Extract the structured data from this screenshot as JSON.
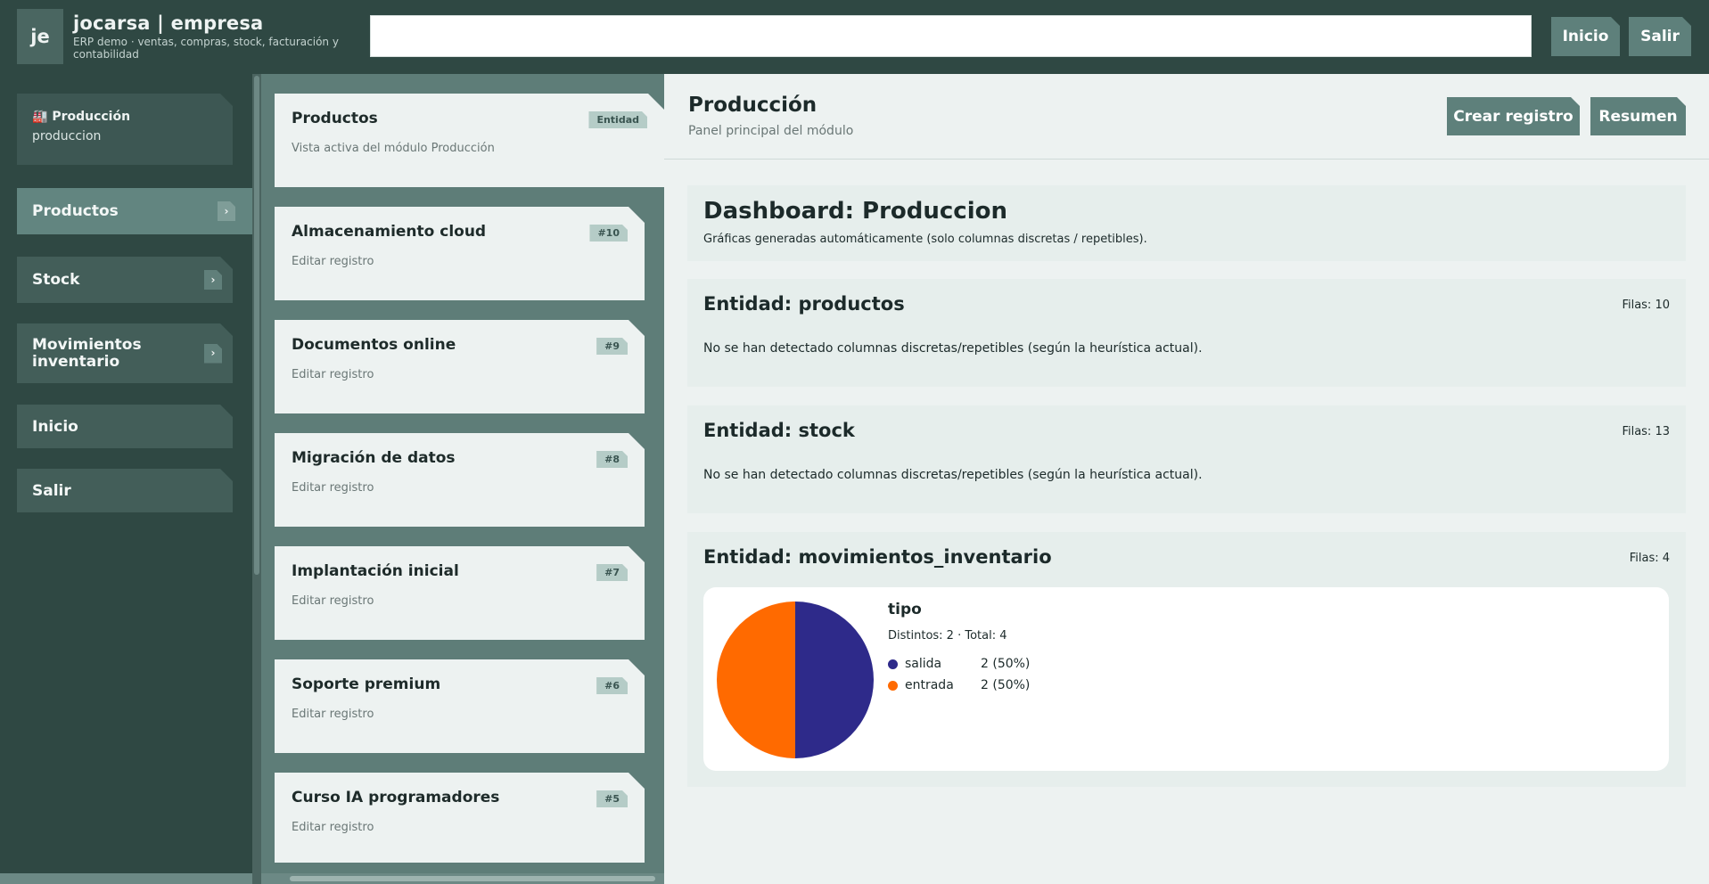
{
  "header": {
    "logo": "je",
    "title": "jocarsa | empresa",
    "subtitle": "ERP demo · ventas, compras, stock, facturación y contabilidad",
    "search_value": "",
    "buttons": [
      "Inicio",
      "Salir"
    ]
  },
  "sidebar": {
    "module": {
      "icon": "🏭",
      "title": "Producción",
      "slug": "produccion"
    },
    "items": [
      {
        "label": "Productos",
        "active": true,
        "chevron": "›"
      },
      {
        "label": "Stock",
        "active": false,
        "chevron": "›"
      },
      {
        "label": "Movimientos inventario",
        "active": false,
        "chevron": "›"
      },
      {
        "label": "Inicio",
        "active": false
      },
      {
        "label": "Salir",
        "active": false
      }
    ]
  },
  "list": {
    "active_card": {
      "title": "Productos",
      "subtitle": "Vista activa del módulo Producción",
      "badge": "Entidad"
    },
    "records": [
      {
        "title": "Almacenamiento cloud",
        "subtitle": "Editar registro",
        "badge": "#10"
      },
      {
        "title": "Documentos online",
        "subtitle": "Editar registro",
        "badge": "#9"
      },
      {
        "title": "Migración de datos",
        "subtitle": "Editar registro",
        "badge": "#8"
      },
      {
        "title": "Implantación inicial",
        "subtitle": "Editar registro",
        "badge": "#7"
      },
      {
        "title": "Soporte premium",
        "subtitle": "Editar registro",
        "badge": "#6"
      },
      {
        "title": "Curso IA programadores",
        "subtitle": "Editar registro",
        "badge": "#5"
      }
    ]
  },
  "main": {
    "title": "Producción",
    "subtitle": "Panel principal del módulo",
    "buttons": {
      "create": "Crear registro",
      "summary": "Resumen"
    },
    "dashboard": {
      "title": "Dashboard: Produccion",
      "subtitle": "Gráficas generadas automáticamente (solo columnas discretas / repetibles)."
    },
    "entities": [
      {
        "title": "Entidad: productos",
        "rows": "Filas: 10",
        "message": "No se han detectado columnas discretas/repetibles (según la heurística actual)."
      },
      {
        "title": "Entidad: stock",
        "rows": "Filas: 13",
        "message": "No se han detectado columnas discretas/repetibles (según la heurística actual)."
      },
      {
        "title": "Entidad: movimientos_inventario",
        "rows": "Filas: 4"
      }
    ],
    "chart": {
      "title": "tipo",
      "meta": "Distintos: 2 · Total: 4",
      "legend": [
        {
          "name": "salida",
          "value": "2 (50%)"
        },
        {
          "name": "entrada",
          "value": "2 (50%)"
        }
      ]
    }
  },
  "chart_data": {
    "type": "pie",
    "title": "tipo",
    "categories": [
      "salida",
      "entrada"
    ],
    "values": [
      2,
      2
    ],
    "colors": [
      "#2e2a8a",
      "#ff6a00"
    ]
  },
  "colors": {
    "sidebar_bg": "#2f4843",
    "accent": "#5e807b",
    "main_bg": "#edf2f1"
  }
}
